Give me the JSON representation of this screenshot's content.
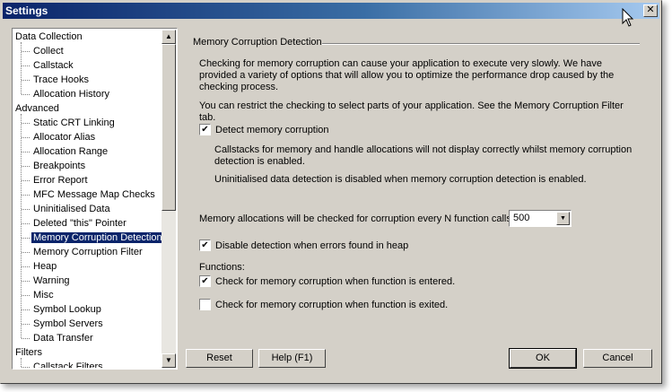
{
  "window": {
    "title": "Settings",
    "close_label": "✕"
  },
  "tree": {
    "items": [
      {
        "label": "Data Collection",
        "level": 0
      },
      {
        "label": "Collect",
        "level": 1
      },
      {
        "label": "Callstack",
        "level": 1
      },
      {
        "label": "Trace Hooks",
        "level": 1
      },
      {
        "label": "Allocation History",
        "level": 1
      },
      {
        "label": "Advanced",
        "level": 0
      },
      {
        "label": "Static CRT Linking",
        "level": 1
      },
      {
        "label": "Allocator Alias",
        "level": 1
      },
      {
        "label": "Allocation Range",
        "level": 1
      },
      {
        "label": "Breakpoints",
        "level": 1
      },
      {
        "label": "Error Report",
        "level": 1
      },
      {
        "label": "MFC Message Map Checks",
        "level": 1
      },
      {
        "label": "Uninitialised Data",
        "level": 1
      },
      {
        "label": "Deleted \"this\" Pointer",
        "level": 1
      },
      {
        "label": "Memory Corruption Detection",
        "level": 1,
        "selected": true
      },
      {
        "label": "Memory Corruption Filter",
        "level": 1
      },
      {
        "label": "Heap",
        "level": 1
      },
      {
        "label": "Warning",
        "level": 1
      },
      {
        "label": "Misc",
        "level": 1
      },
      {
        "label": "Symbol Lookup",
        "level": 1
      },
      {
        "label": "Symbol Servers",
        "level": 1
      },
      {
        "label": "Data Transfer",
        "level": 1
      },
      {
        "label": "Filters",
        "level": 0
      },
      {
        "label": "Callstack Filters",
        "level": 1
      }
    ]
  },
  "panel": {
    "heading": "Memory Corruption Detection",
    "intro": "Checking for memory corruption can cause your application to execute very slowly. We have provided a variety of options that will allow you to optimize the performance drop caused by the checking process.",
    "restrict": "You can restrict the checking to select parts of your application. See the Memory Corruption Filter tab.",
    "detect_label": "Detect memory corruption",
    "detect_checked": true,
    "note1": "Callstacks for memory and handle allocations will not display correctly whilst memory corruption detection is enabled.",
    "note2": "Uninitialised data detection is disabled when memory corruption detection is enabled.",
    "interval_label": "Memory allocations will be checked for corruption every N function calls.",
    "interval_value": "500",
    "disable_heap_label": "Disable detection when errors found in heap",
    "disable_heap_checked": true,
    "functions_label": "Functions:",
    "entered_label": "Check for memory corruption when function is entered.",
    "entered_checked": true,
    "exited_label": "Check for memory corruption when function is exited.",
    "exited_checked": false
  },
  "buttons": {
    "reset": "Reset",
    "help": "Help (F1)",
    "ok": "OK",
    "cancel": "Cancel"
  },
  "icons": {
    "check": "✔",
    "scroll_up": "▲",
    "scroll_down": "▼",
    "dropdown": "▼"
  }
}
